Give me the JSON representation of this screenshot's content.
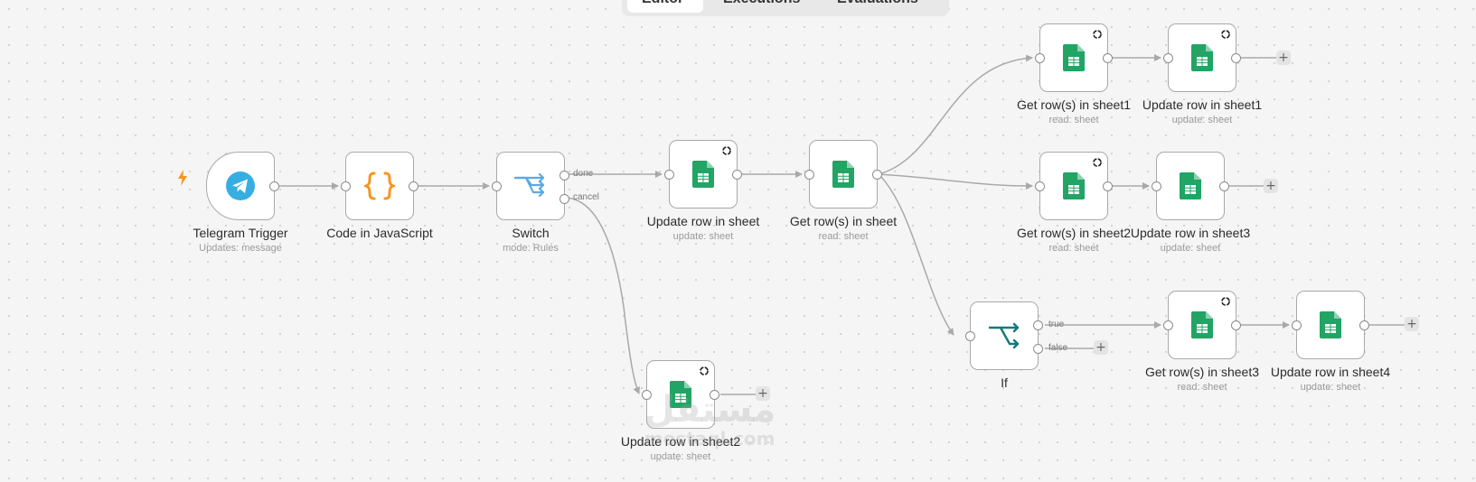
{
  "tabs": {
    "editor": "Editor",
    "executions": "Executions",
    "evaluations": "Evaluations"
  },
  "nodes": {
    "telegram_trigger": {
      "title": "Telegram Trigger",
      "subtitle": "Updates: message"
    },
    "code_js": {
      "title": "Code in JavaScript",
      "subtitle": ""
    },
    "switch": {
      "title": "Switch",
      "subtitle": "mode: Rules",
      "out_done": "done",
      "out_cancel": "cancel"
    },
    "update_row_sheet": {
      "title": "Update row in sheet",
      "subtitle": "update: sheet"
    },
    "get_rows_sheet": {
      "title": "Get row(s) in sheet",
      "subtitle": "read: sheet"
    },
    "get_rows_sheet1": {
      "title": "Get row(s) in sheet1",
      "subtitle": "read: sheet"
    },
    "update_row_sheet1": {
      "title": "Update row in sheet1",
      "subtitle": "update: sheet"
    },
    "get_rows_sheet2": {
      "title": "Get row(s) in sheet2",
      "subtitle": "read: sheet"
    },
    "update_row_sheet3": {
      "title": "Update row in sheet3",
      "subtitle": "update: sheet"
    },
    "if_node": {
      "title": "If",
      "subtitle": "",
      "out_true": "true",
      "out_false": "false"
    },
    "get_rows_sheet3": {
      "title": "Get row(s) in sheet3",
      "subtitle": "read: sheet"
    },
    "update_row_sheet4": {
      "title": "Update row in sheet4",
      "subtitle": "update: sheet"
    },
    "update_row_sheet2": {
      "title": "Update row in sheet2",
      "subtitle": "update: sheet"
    }
  },
  "plus_label": "+",
  "watermark": {
    "arabic": "مستقل",
    "latin": "mostaql.com"
  },
  "colors": {
    "canvas": "#f5f5f5",
    "wire": "#a9a9a9",
    "sheets_green": "#21a464",
    "telegram_blue": "#37aee2",
    "code_orange": "#f7941d",
    "switch_blue": "#5aa9e6",
    "if_teal": "#127a7a"
  }
}
